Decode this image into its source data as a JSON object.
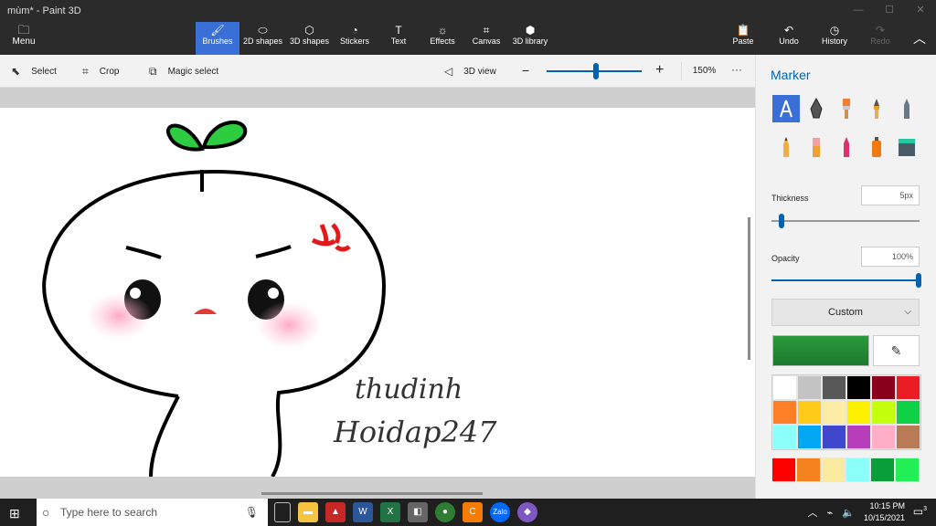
{
  "window": {
    "title": "mùm* - Paint 3D"
  },
  "ribbon": {
    "menu_label": "Menu",
    "tools": [
      {
        "label": "Brushes",
        "icon": "brush-icon",
        "active": true
      },
      {
        "label": "2D shapes",
        "icon": "2d-shapes-icon",
        "active": false
      },
      {
        "label": "3D shapes",
        "icon": "3d-shapes-icon",
        "active": false
      },
      {
        "label": "Stickers",
        "icon": "stickers-icon",
        "active": false
      },
      {
        "label": "Text",
        "icon": "text-icon",
        "active": false
      },
      {
        "label": "Effects",
        "icon": "effects-icon",
        "active": false
      },
      {
        "label": "Canvas",
        "icon": "canvas-icon",
        "active": false
      },
      {
        "label": "3D library",
        "icon": "3d-library-icon",
        "active": false
      }
    ],
    "right": [
      {
        "label": "Paste",
        "icon": "paste-icon"
      },
      {
        "label": "Undo",
        "icon": "undo-icon"
      },
      {
        "label": "History",
        "icon": "history-icon"
      },
      {
        "label": "Redo",
        "icon": "redo-icon"
      }
    ]
  },
  "subbar": {
    "select": "Select",
    "crop": "Crop",
    "magic_select": "Magic select",
    "view3d": "3D view",
    "zoom": "150%",
    "zoom_level": 0.5
  },
  "canvas": {
    "text1": "thudinh",
    "text2": "Hoidap247"
  },
  "panel": {
    "title": "Marker",
    "brushes": [
      {
        "name": "marker-brush-icon",
        "selected": true
      },
      {
        "name": "calligraphy-pen-icon",
        "selected": false
      },
      {
        "name": "oil-brush-icon",
        "selected": false
      },
      {
        "name": "watercolor-brush-icon",
        "selected": false
      },
      {
        "name": "pixel-pen-icon",
        "selected": false
      },
      {
        "name": "pencil-icon",
        "selected": false
      },
      {
        "name": "eraser-icon",
        "selected": false
      },
      {
        "name": "crayon-icon",
        "selected": false
      },
      {
        "name": "spray-can-icon",
        "selected": false
      },
      {
        "name": "fill-bucket-icon",
        "selected": false
      }
    ],
    "thickness_label": "Thickness",
    "thickness_value": "5px",
    "thickness_level": 0.05,
    "opacity_label": "Opacity",
    "opacity_value": "100%",
    "opacity_level": 1.0,
    "finish_value": "Custom",
    "current_color": "#2a9a3c",
    "palette": [
      "#ffffff",
      "#c3c3c3",
      "#585858",
      "#000000",
      "#88001b",
      "#ec1c24",
      "#ff7f27",
      "#ffca18",
      "#fdeca6",
      "#fff200",
      "#c4ff0e",
      "#0ed145",
      "#8cfffb",
      "#00a8f3",
      "#3f48cc",
      "#b83dba",
      "#ffaec8",
      "#b97a56"
    ],
    "custom_colors": [
      "#ff0000",
      "#f5821f",
      "#fbeba0",
      "#8cfffb",
      "#0a9e3a",
      "#22ee55"
    ]
  },
  "taskbar": {
    "search_placeholder": "Type here to search",
    "time": "10:15 PM",
    "date": "10/15/2021",
    "notification_count": "3"
  }
}
